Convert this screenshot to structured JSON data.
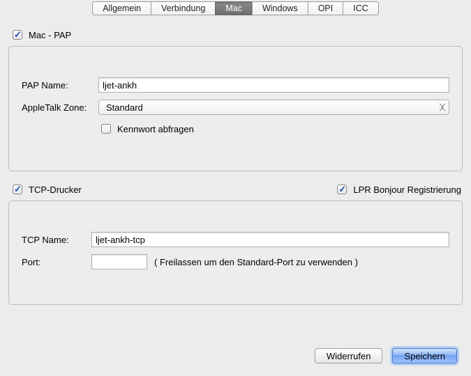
{
  "tabs": {
    "items": [
      {
        "label": "Allgemein"
      },
      {
        "label": "Verbindung"
      },
      {
        "label": "Mac"
      },
      {
        "label": "Windows"
      },
      {
        "label": "OPI"
      },
      {
        "label": "ICC"
      }
    ],
    "selected_index": 2
  },
  "mac_pap": {
    "checkbox_label": "Mac - PAP",
    "checked": true,
    "pap_name_label": "PAP Name:",
    "pap_name_value": "ljet-ankh",
    "appletalk_zone_label": "AppleTalk Zone:",
    "appletalk_zone_value": "Standard",
    "ask_password_label": "Kennwort abfragen",
    "ask_password_checked": false
  },
  "tcp": {
    "tcp_printer_label": "TCP-Drucker",
    "tcp_printer_checked": true,
    "lpr_bonjour_label": "LPR Bonjour Registrierung",
    "lpr_bonjour_checked": true,
    "tcp_name_label": "TCP Name:",
    "tcp_name_value": "ljet-ankh-tcp",
    "port_label": "Port:",
    "port_value": "",
    "port_hint": "( Freilassen um den Standard-Port zu verwenden )"
  },
  "buttons": {
    "revert": "Widerrufen",
    "save": "Speichern"
  }
}
